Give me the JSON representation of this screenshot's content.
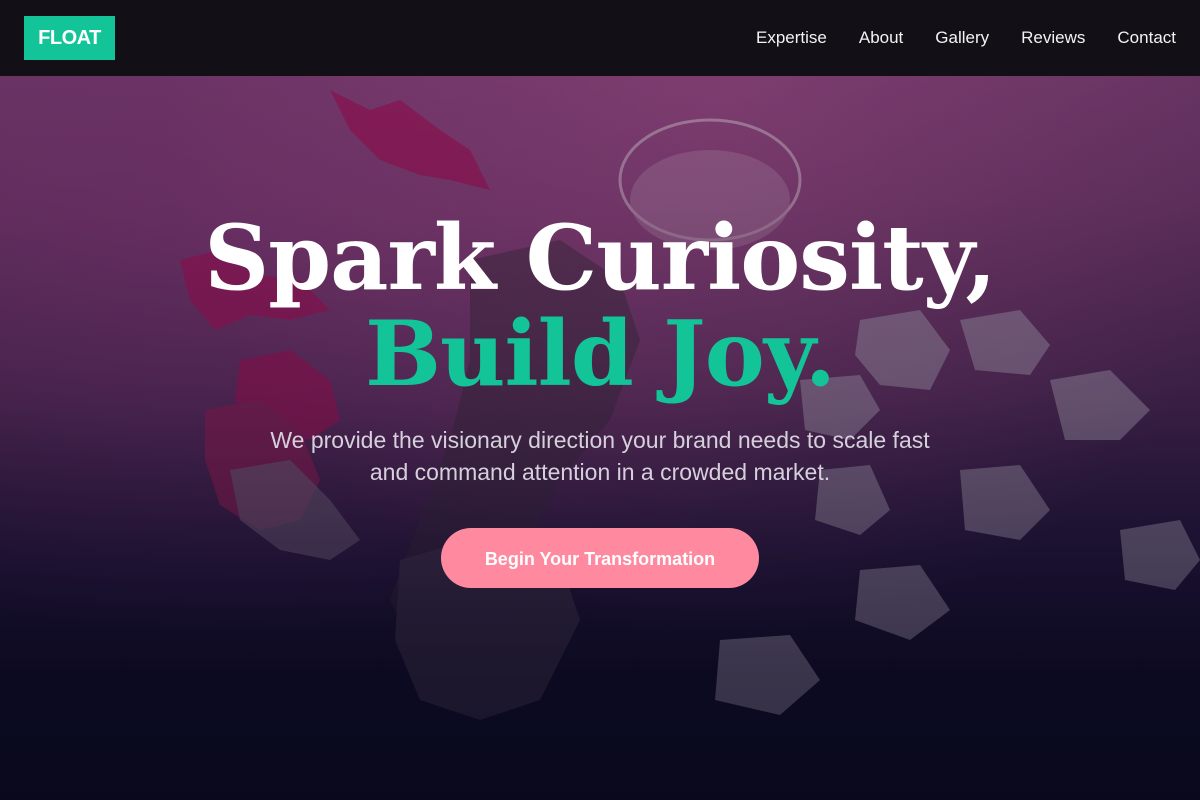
{
  "brand": {
    "logo_text": "FLOAT",
    "accent_color": "#12c497",
    "cta_color": "#ff8aa0"
  },
  "nav": {
    "items": [
      {
        "label": "Expertise"
      },
      {
        "label": "About"
      },
      {
        "label": "Gallery"
      },
      {
        "label": "Reviews"
      },
      {
        "label": "Contact"
      }
    ]
  },
  "hero": {
    "headline_line1": "Spark Curiosity,",
    "headline_line2": "Build Joy.",
    "subtext": "We provide the visionary direction your brand needs to scale fast and command attention in a crowded market.",
    "cta_label": "Begin Your Transformation"
  }
}
